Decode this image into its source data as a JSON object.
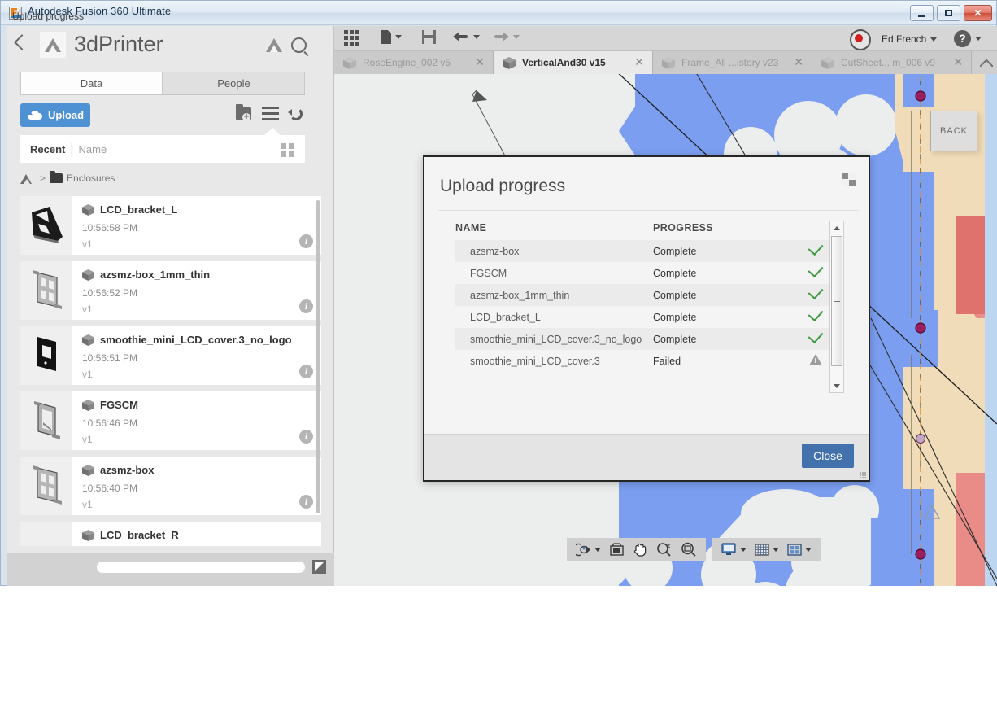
{
  "window": {
    "title": "Autodesk Fusion 360 Ultimate",
    "minimize_label": "",
    "maximize_label": "",
    "close_label": "✕"
  },
  "data_panel": {
    "project_title": "3dPrinter",
    "close_label": "✕",
    "tabs": [
      {
        "label": "Data",
        "active": true
      },
      {
        "label": "People",
        "active": false
      }
    ],
    "upload_button": "Upload",
    "sort": {
      "primary": "Recent",
      "separator": "|",
      "secondary": "Name"
    },
    "breadcrumb": {
      "separator": ">",
      "folder": "Enclosures"
    },
    "files": [
      {
        "name": "LCD_bracket_L",
        "time": "10:56:58 PM",
        "version": "v1",
        "thumb": "bracket-dark"
      },
      {
        "name": "azsmz-box_1mm_thin",
        "time": "10:56:52 PM",
        "version": "v1",
        "thumb": "box-frame"
      },
      {
        "name": "smoothie_mini_LCD_cover.3_no_logo",
        "time": "10:56:51 PM",
        "version": "v1",
        "thumb": "cover-dark"
      },
      {
        "name": "FGSCM",
        "time": "10:56:46 PM",
        "version": "v1",
        "thumb": "frame-gray"
      },
      {
        "name": "azsmz-box",
        "time": "10:56:40 PM",
        "version": "v1",
        "thumb": "box-frame"
      },
      {
        "name": "LCD_bracket_R",
        "time": "",
        "version": "",
        "thumb": "bracket-dark"
      }
    ],
    "status": {
      "label": "Upload progress",
      "progress_percent": 0
    }
  },
  "app_toolbar": {
    "user_name": "Ed French",
    "user_caret": "▼",
    "help_glyph": "?",
    "help_caret": "▼"
  },
  "doc_tabs": [
    {
      "label": "RoseEngine_002 v5",
      "active": false,
      "close": "✕"
    },
    {
      "label": "VerticalAnd30 v15",
      "active": true,
      "close": "✕"
    },
    {
      "label": "Frame_All ...istory v23",
      "active": false,
      "close": "✕"
    },
    {
      "label": "CutSheet... m_006 v9",
      "active": false,
      "close": "✕"
    }
  ],
  "viewport": {
    "view_cube_label": "BACK"
  },
  "nav_toolbar": {
    "groups": [
      [
        "orbit-icon",
        "fit-icon",
        "pan-icon",
        "zoom-icon",
        "zoom-window-icon"
      ],
      [
        "display-settings-icon",
        "grid-snap-icon",
        "viewports-icon"
      ]
    ]
  },
  "upload_dialog": {
    "title": "Upload progress",
    "columns": {
      "name": "NAME",
      "progress": "PROGRESS"
    },
    "rows": [
      {
        "name": "azsmz-box",
        "progress": "Complete",
        "status": "check"
      },
      {
        "name": "FGSCM",
        "progress": "Complete",
        "status": "check"
      },
      {
        "name": "azsmz-box_1mm_thin",
        "progress": "Complete",
        "status": "check"
      },
      {
        "name": "LCD_bracket_L",
        "progress": "Complete",
        "status": "check"
      },
      {
        "name": "smoothie_mini_LCD_cover.3_no_logo",
        "progress": "Complete",
        "status": "check"
      },
      {
        "name": "smoothie_mini_LCD_cover.3",
        "progress": "Failed",
        "status": "warn"
      }
    ],
    "close_button": "Close"
  },
  "colors": {
    "accent_blue": "#4f92d4",
    "dialog_button_blue": "#4271ab",
    "success_green": "#3f9a3f",
    "warning_gray": "#9c9c9c",
    "cad_blue": "#7b9ef0",
    "cad_tan": "#f0dcb8",
    "cad_red": "#e98b87"
  }
}
